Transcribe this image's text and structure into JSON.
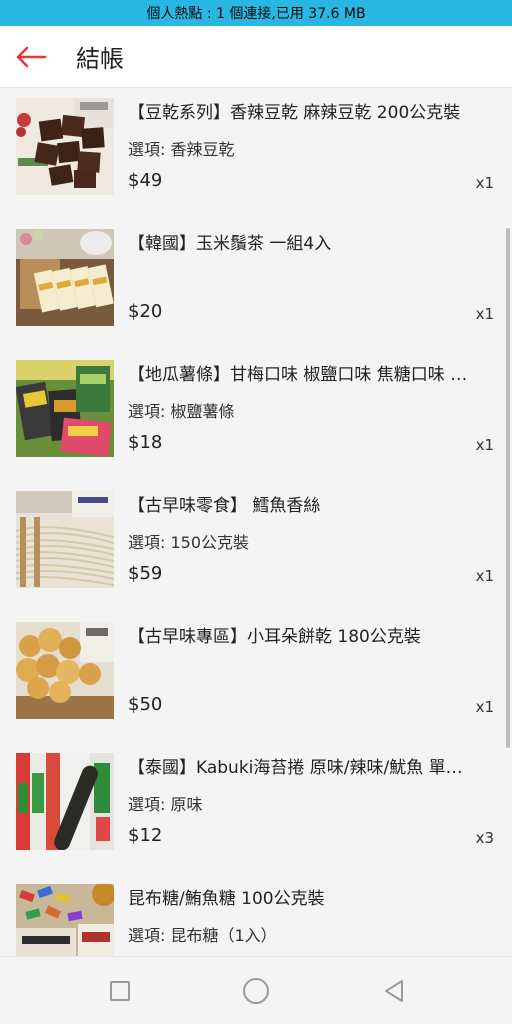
{
  "status_bar": {
    "text": "個人熱點 : 1 個連接,已用 37.6 MB"
  },
  "header": {
    "title": "結帳",
    "back_icon": "arrow-left-icon",
    "accent": "#e53935"
  },
  "items": [
    {
      "title": "【豆乾系列】香辣豆乾 麻辣豆乾 200公克裝",
      "option": "選項: 香辣豆乾",
      "price": "$49",
      "qty": "x1"
    },
    {
      "title": "【韓國】玉米鬚茶 一組4入",
      "option": "",
      "price": "$20",
      "qty": "x1"
    },
    {
      "title": "【地瓜薯條】甘梅口味 椒鹽口味 焦糖口味 …",
      "option": "選項: 椒鹽薯條",
      "price": "$18",
      "qty": "x1"
    },
    {
      "title": "【古早味零食】 鱈魚香絲",
      "option": "選項: 150公克裝",
      "price": "$59",
      "qty": "x1"
    },
    {
      "title": "【古早味專區】小耳朵餅乾 180公克裝",
      "option": "",
      "price": "$50",
      "qty": "x1"
    },
    {
      "title": "【泰國】Kabuki海苔捲 原味/辣味/魷魚 單…",
      "option": "選項: 原味",
      "price": "$12",
      "qty": "x3"
    },
    {
      "title": "昆布糖/鮪魚糖 100公克裝",
      "option": "選項: 昆布糖（1入）",
      "price": "",
      "qty": ""
    }
  ],
  "nav": {
    "recent": "square-icon",
    "home": "circle-icon",
    "back": "triangle-back-icon"
  }
}
